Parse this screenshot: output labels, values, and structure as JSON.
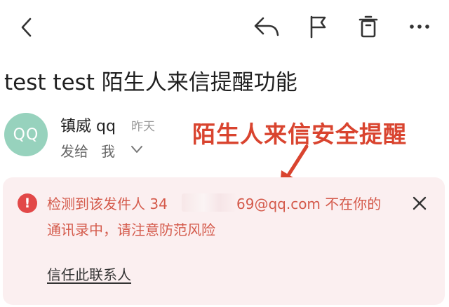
{
  "toolbar": {
    "back_icon": "chevron-left-icon",
    "reply_icon": "reply-icon",
    "flag_icon": "flag-icon",
    "delete_icon": "trash-icon",
    "more_icon": "more-dots-icon"
  },
  "email": {
    "subject": "test test 陌生人来信提醒功能",
    "sender_name": "镇威 qq",
    "sender_avatar_text": "QQ",
    "date": "昨天",
    "recipient_label": "发给",
    "recipient": "我"
  },
  "annotation": {
    "text": "陌生人来信安全提醒"
  },
  "warning": {
    "line1_prefix": "检测到该发件人 34",
    "line1_suffix": "69@qq.com 不在你的",
    "line2": "通讯录中，请注意防范风险",
    "trust_link": "信任此联系人",
    "icon": "exclamation-icon",
    "close_icon": "close-icon"
  },
  "colors": {
    "accent_red": "#d9442f",
    "warning_text": "#d45a4b",
    "warning_bg": "#fbeff0",
    "avatar_bg": "#97d2bd"
  }
}
